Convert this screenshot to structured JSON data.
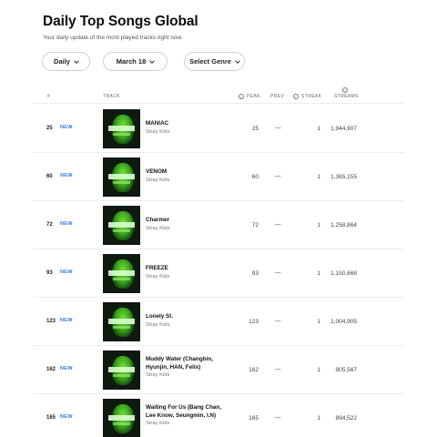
{
  "header": {
    "title": "Daily Top Songs Global",
    "subtitle": "Your daily update of the most played tracks right now."
  },
  "filters": {
    "frequency": "Daily",
    "date": "March 18",
    "genre": "Select Genre"
  },
  "table": {
    "columns": {
      "rank": "#",
      "track": "TRACK",
      "peak": "PEAK",
      "prev": "PREV",
      "streak": "STREAK",
      "streams": "STREAMS"
    },
    "rows": [
      {
        "rank": "25",
        "badge": "NEW",
        "song": "MANIAC",
        "artist": "Stray Kids",
        "peak": "25",
        "prev": "—",
        "streak": "1",
        "streams": "1,944,907"
      },
      {
        "rank": "60",
        "badge": "NEW",
        "song": "VENOM",
        "artist": "Stray Kids",
        "peak": "60",
        "prev": "—",
        "streak": "1",
        "streams": "1,365,155"
      },
      {
        "rank": "72",
        "badge": "NEW",
        "song": "Charmer",
        "artist": "Stray Kids",
        "peak": "72",
        "prev": "—",
        "streak": "1",
        "streams": "1,258,864"
      },
      {
        "rank": "93",
        "badge": "NEW",
        "song": "FREEZE",
        "artist": "Stray Kids",
        "peak": "93",
        "prev": "—",
        "streak": "1",
        "streams": "1,150,668"
      },
      {
        "rank": "123",
        "badge": "NEW",
        "song": "Lonely St.",
        "artist": "Stray Kids",
        "peak": "123",
        "prev": "—",
        "streak": "1",
        "streams": "1,004,905"
      },
      {
        "rank": "162",
        "badge": "NEW",
        "song": "Muddy Water (Changbin, Hyunjin, HAN, Felix)",
        "artist": "Stray Kids",
        "peak": "162",
        "prev": "—",
        "streak": "1",
        "streams": "905,567"
      },
      {
        "rank": "165",
        "badge": "NEW",
        "song": "Waiting For Us (Bang Chan, Lee Know, Seungmin, I.N)",
        "artist": "Stray Kids",
        "peak": "165",
        "prev": "—",
        "streak": "1",
        "streams": "894,522"
      }
    ]
  },
  "colors": {
    "new_badge": "#2f7bd8",
    "album_art_green": "#3aa61d"
  }
}
